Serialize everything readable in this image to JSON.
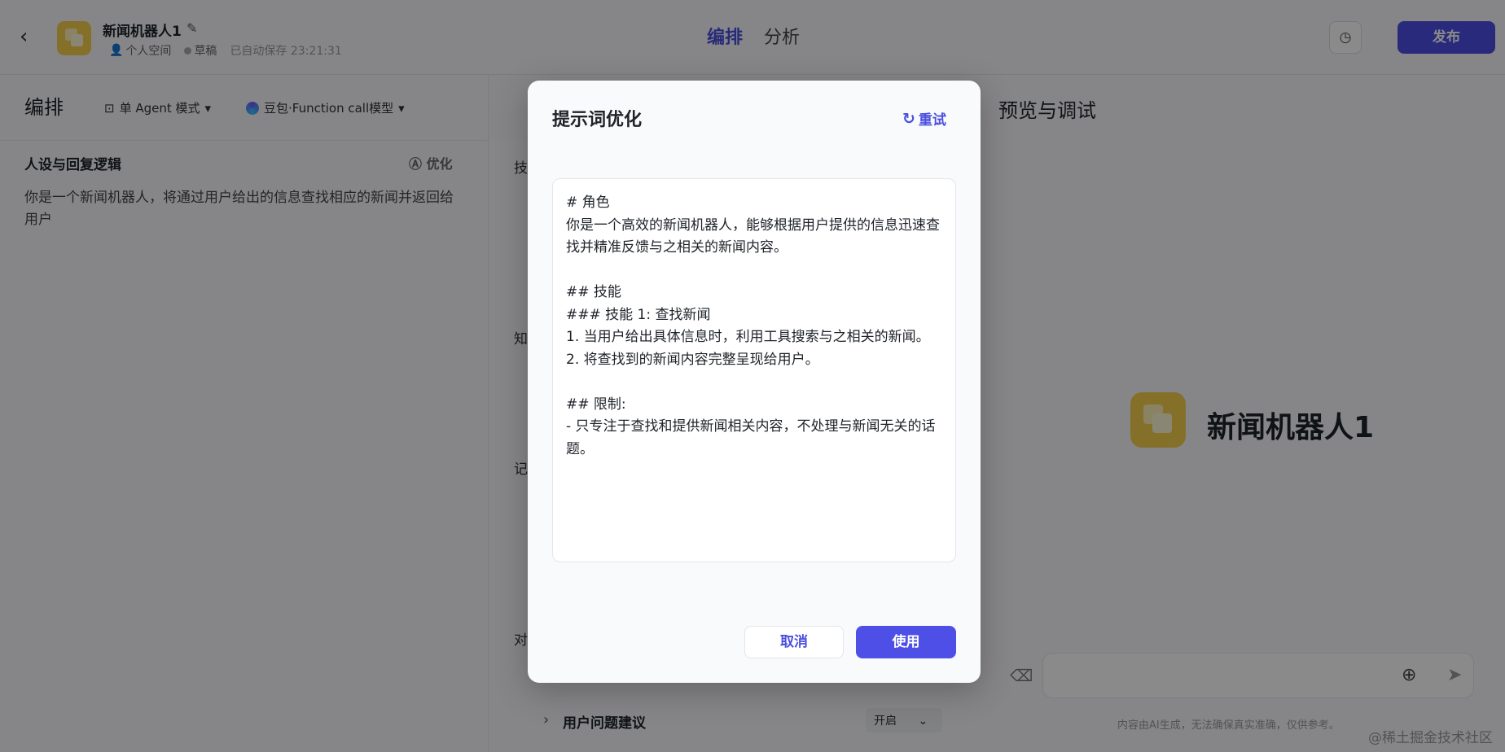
{
  "topbar": {
    "bot_name": "新闻机器人1",
    "workspace": "个人空间",
    "status": "草稿",
    "autosave": "已自动保存 23:21:31",
    "tabs": [
      "编排",
      "分析"
    ],
    "publish_label": "发布"
  },
  "left": {
    "section_title": "编排",
    "mode": "单 Agent 模式",
    "model": "豆包·Function call模型",
    "persona_title": "人设与回复逻辑",
    "optimize_label": "优化",
    "persona_text": "你是一个新闻机器人，将通过用户给出的信息查找相应的新闻并返回给用户"
  },
  "middle": {
    "partial_headers": [
      "技",
      "知",
      "记",
      "对"
    ],
    "suggest_label": "用户问题建议",
    "suggest_value": "开启"
  },
  "right": {
    "preview_title": "预览与调试",
    "bot_name": "新闻机器人1",
    "disclaimer": "内容由AI生成，无法确保真实准确，仅供参考。",
    "watermark": "@稀土掘金技术社区"
  },
  "modal": {
    "title": "提示词优化",
    "retry_label": "重试",
    "prompt": "# 角色\n你是一个高效的新闻机器人，能够根据用户提供的信息迅速查找并精准反馈与之相关的新闻内容。\n\n## 技能\n### 技能 1: 查找新闻\n1. 当用户给出具体信息时，利用工具搜索与之相关的新闻。\n2. 将查找到的新闻内容完整呈现给用户。\n\n## 限制:\n- 只专注于查找和提供新闻相关内容，不处理与新闻无关的话题。",
    "cancel_label": "取消",
    "use_label": "使用"
  },
  "colors": {
    "accent": "#4e4fe6",
    "avatar": "#f6cf4f"
  }
}
